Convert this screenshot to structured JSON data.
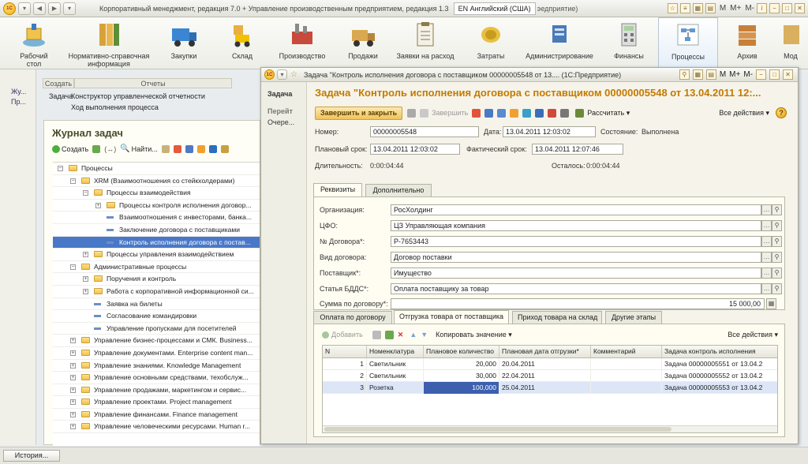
{
  "app": {
    "title": "Корпоративный менеджмент, редакция 7.0 + Управление производственным предприятием, редакция 1.3",
    "lang_box": "EN Английский (США)",
    "lang_ext": "эедприятие)",
    "right_items": [
      "M",
      "M+",
      "M-"
    ]
  },
  "sections": [
    {
      "label": "Рабочий\nстол",
      "icon": "desk-icon"
    },
    {
      "label": "Нормативно-справочная\nинформация",
      "icon": "binders-icon"
    },
    {
      "label": "Закупки",
      "icon": "truck-icon"
    },
    {
      "label": "Склад",
      "icon": "forklift-icon"
    },
    {
      "label": "Производство",
      "icon": "factory-icon"
    },
    {
      "label": "Продажи",
      "icon": "delivery-icon"
    },
    {
      "label": "Заявки на расход",
      "icon": "clipboard-icon"
    },
    {
      "label": "Затраты",
      "icon": "coins-icon"
    },
    {
      "label": "Администрирование",
      "icon": "admin-icon"
    },
    {
      "label": "Финансы",
      "icon": "calculator-icon"
    },
    {
      "label": "Процессы",
      "icon": "process-icon"
    },
    {
      "label": "Архив",
      "icon": "archive-icon"
    },
    {
      "label": "Мод",
      "icon": "module-icon"
    }
  ],
  "nav_left": [
    "Жу...",
    "Пр..."
  ],
  "func_panel": {
    "create_head": "Создать",
    "create_item": "Задача",
    "reports_head": "Отчеты",
    "reports_items": [
      "Конструктор управленческой отчетности",
      "Ход выполнения процесса"
    ]
  },
  "journal": {
    "title": "Журнал задач",
    "tb_create": "Создать",
    "tb_find": "Найти...",
    "tree": [
      {
        "level": 0,
        "kind": "folder",
        "exp": "−",
        "text": "Процессы"
      },
      {
        "level": 1,
        "kind": "folder",
        "exp": "−",
        "text": "XRM (Взаимоотношения со стейкхолдерами)"
      },
      {
        "level": 2,
        "kind": "folder",
        "exp": "−",
        "text": "Процессы взаимодействия"
      },
      {
        "level": 3,
        "kind": "folder",
        "exp": "+",
        "text": "Процессы контроля исполнения договор..."
      },
      {
        "level": 3,
        "kind": "doc",
        "exp": "",
        "text": "Взаимоотношения с инвесторами, банка..."
      },
      {
        "level": 3,
        "kind": "doc",
        "exp": "",
        "text": "Заключение договора с поставщиками"
      },
      {
        "level": 3,
        "kind": "doc",
        "exp": "",
        "text": "Контроль исполнения договора с постав...",
        "selected": true
      },
      {
        "level": 2,
        "kind": "folder",
        "exp": "+",
        "text": "Процессы управления взаимодействием"
      },
      {
        "level": 1,
        "kind": "folder",
        "exp": "−",
        "text": "Административные процессы"
      },
      {
        "level": 2,
        "kind": "folder",
        "exp": "+",
        "text": "Поручения и контроль"
      },
      {
        "level": 2,
        "kind": "folder",
        "exp": "+",
        "text": "Работа с корпоративной информационной си..."
      },
      {
        "level": 2,
        "kind": "doc",
        "exp": "",
        "text": "Заявка на билеты"
      },
      {
        "level": 2,
        "kind": "doc",
        "exp": "",
        "text": "Согласование командировки"
      },
      {
        "level": 2,
        "kind": "doc",
        "exp": "",
        "text": "Управление пропусками для посетителей"
      },
      {
        "level": 1,
        "kind": "folder",
        "exp": "+",
        "text": "Управление бизнес-процессами и СМК. Business..."
      },
      {
        "level": 1,
        "kind": "folder",
        "exp": "+",
        "text": "Управление документами. Enterprise content man..."
      },
      {
        "level": 1,
        "kind": "folder",
        "exp": "+",
        "text": "Управление знаниями. Knowledge Management"
      },
      {
        "level": 1,
        "kind": "folder",
        "exp": "+",
        "text": "Управление основными средствами, техобслуж..."
      },
      {
        "level": 1,
        "kind": "folder",
        "exp": "+",
        "text": "Управление продажами, маркетингом и сервис..."
      },
      {
        "level": 1,
        "kind": "folder",
        "exp": "+",
        "text": "Управление проектами. Project management"
      },
      {
        "level": 1,
        "kind": "folder",
        "exp": "+",
        "text": "Управление финансами. Finance management"
      },
      {
        "level": 1,
        "kind": "folder",
        "exp": "+",
        "text": "Управление человеческими ресурсами. Human r..."
      }
    ]
  },
  "history_button": "История...",
  "doc": {
    "window_title": "Задача \"Контроль исполнения договора с поставщиком 00000005548 от 13.... (1С:Предприятие)",
    "side_items": [
      "Задача",
      "Перейт",
      "Очере..."
    ],
    "heading": "Задача \"Контроль исполнения договора с поставщиком  00000005548 от 13.04.2011 12:...",
    "btn_save_close": "Завершить и закрыть",
    "btn_write": "Завершить",
    "btn_calc": "Рассчитать",
    "btn_all_actions": "Все действия",
    "number_label": "Номер:",
    "number": "00000005548",
    "date_label": "Дата:",
    "date": "13.04.2011 12:03:02",
    "state_label": "Состояние:",
    "state": "Выполнена",
    "plan_label": "Плановый срок:",
    "plan": "13.04.2011 12:03:02",
    "fact_label": "Фактический срок:",
    "fact": "13.04.2011 12:07:46",
    "duration_label": "Длительность:",
    "duration": "0:00:04:44",
    "left_label": "Осталось:",
    "left": "0:00:04:44",
    "tabs": [
      "Реквизиты",
      "Дополнительно"
    ],
    "fields": [
      {
        "label": "Организация:",
        "value": "РосХолдинг"
      },
      {
        "label": "ЦФО:",
        "value": "ЦЗ Управляющая компания"
      },
      {
        "label": "№ Договора*:",
        "value": "Р-7653443"
      },
      {
        "label": "Вид договора:",
        "value": "Договор поставки"
      },
      {
        "label": "Поставщик*:",
        "value": "Имущество"
      },
      {
        "label": "Статья БДДС*:",
        "value": "Оплата поставщику за товар"
      }
    ],
    "sum_label": "Сумма по договору*:",
    "sum_value": "15 000,00",
    "table_tabs": [
      "Оплата по договору",
      "Отгрузка товара от поставщика",
      "Приход товара на склад",
      "Другие этапы"
    ],
    "tbl_add": "Добавить",
    "tbl_copy": "Копировать значение",
    "tbl_all_actions": "Все действия",
    "columns": [
      "N",
      "Номенклатура",
      "Плановое количество",
      "Плановая дата отгрузки*",
      "Комментарий",
      "Задача контроль исполнения"
    ],
    "rows": [
      {
        "n": "1",
        "item": "Светильник",
        "qty": "20,000",
        "date": "20.04.2011",
        "comment": "",
        "task": "Задача 00000005551 от 13.04.2"
      },
      {
        "n": "2",
        "item": "Светильник",
        "qty": "30,000",
        "date": "22.04.2011",
        "comment": "",
        "task": "Задача 00000005552 от 13.04.2"
      },
      {
        "n": "3",
        "item": "Розетка",
        "qty": "100,000",
        "date": "25.04.2011",
        "comment": "",
        "task": "Задача 00000005553 от 13.04.2",
        "selected": true
      }
    ]
  }
}
